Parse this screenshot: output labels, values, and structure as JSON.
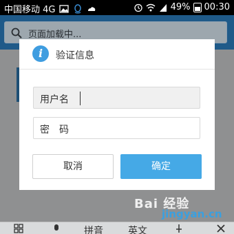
{
  "status_bar": {
    "carrier": "中国移动 4G",
    "battery": "49%",
    "time": "00:30"
  },
  "search": {
    "placeholder": "页面加载中..."
  },
  "dialog": {
    "title": "验证信息",
    "username_label": "用户名",
    "password_label": "密　码",
    "cancel_label": "取消",
    "confirm_label": "确定"
  },
  "watermark": {
    "line1": "Bai 经验",
    "line2": "jingyan.cn"
  },
  "keyboard": {
    "pinyin_label": "拼音",
    "english_label": "英文"
  }
}
